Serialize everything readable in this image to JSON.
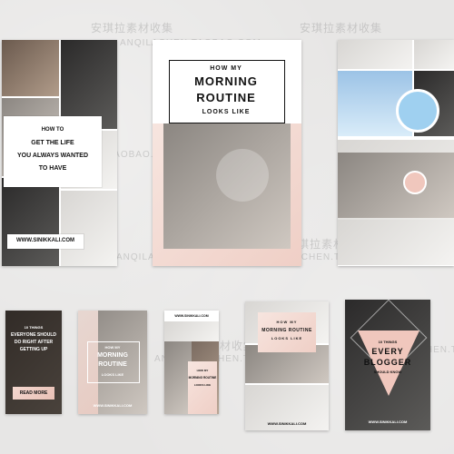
{
  "watermarks": {
    "cn": "安琪拉素材收集",
    "url1": "ANQILACHEN.TAOBAO.COM",
    "url2": "AN ANQILACHEN.TAOBAO.COM"
  },
  "card1": {
    "line1": "HOW TO",
    "line2": "GET THE LIFE",
    "line3": "YOU ALWAYS WANTED",
    "line4": "TO HAVE",
    "site": "WWW.SINIKKALI.COM"
  },
  "card2": {
    "pre": "HOW MY",
    "title1": "MORNING",
    "title2": "ROUTINE",
    "post": "LOOKS LIKE"
  },
  "card5": {
    "line1": "10 THINGS",
    "line2": "EVERYONE SHOULD",
    "line3": "DO RIGHT AFTER",
    "line4": "GETTING UP",
    "btn": "READ MORE"
  },
  "card6": {
    "pre": "HOW MY",
    "title1": "MORNING",
    "title2": "ROUTINE",
    "post": "LOOKS LIKE",
    "site": "WWW.SINIKKALI.COM"
  },
  "card7": {
    "site": "WWW.SINIKKALI.COM",
    "pre": "HOW MY",
    "title": "MORNING ROUTINE",
    "post": "LOOKS LIKE"
  },
  "card8": {
    "pre": "HOW MY",
    "title": "MORNING ROUTINE",
    "post": "LOOKS LIKE",
    "site": "WWW.SINIKKALI.COM"
  },
  "card9": {
    "pre": "10 THINGS",
    "title1": "EVERY",
    "title2": "BLOGGER",
    "post": "SHOULD KNOW",
    "site": "WWW.SINIKKALI.COM"
  }
}
